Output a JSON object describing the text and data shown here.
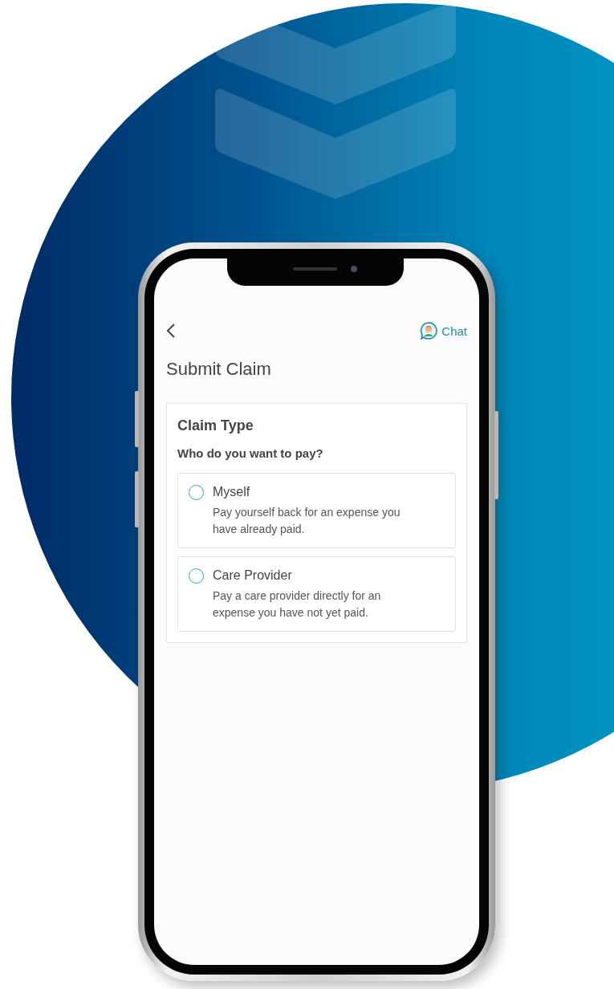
{
  "header": {
    "chat_label": "Chat"
  },
  "title": "Submit Claim",
  "card": {
    "heading": "Claim Type",
    "question": "Who do you want to pay?",
    "options": [
      {
        "label": "Myself",
        "description": "Pay yourself back for an expense you have already paid.",
        "selected": false
      },
      {
        "label": "Care Provider",
        "description": "Pay a care provider directly for an expense you have not yet paid.",
        "selected": false
      }
    ]
  }
}
